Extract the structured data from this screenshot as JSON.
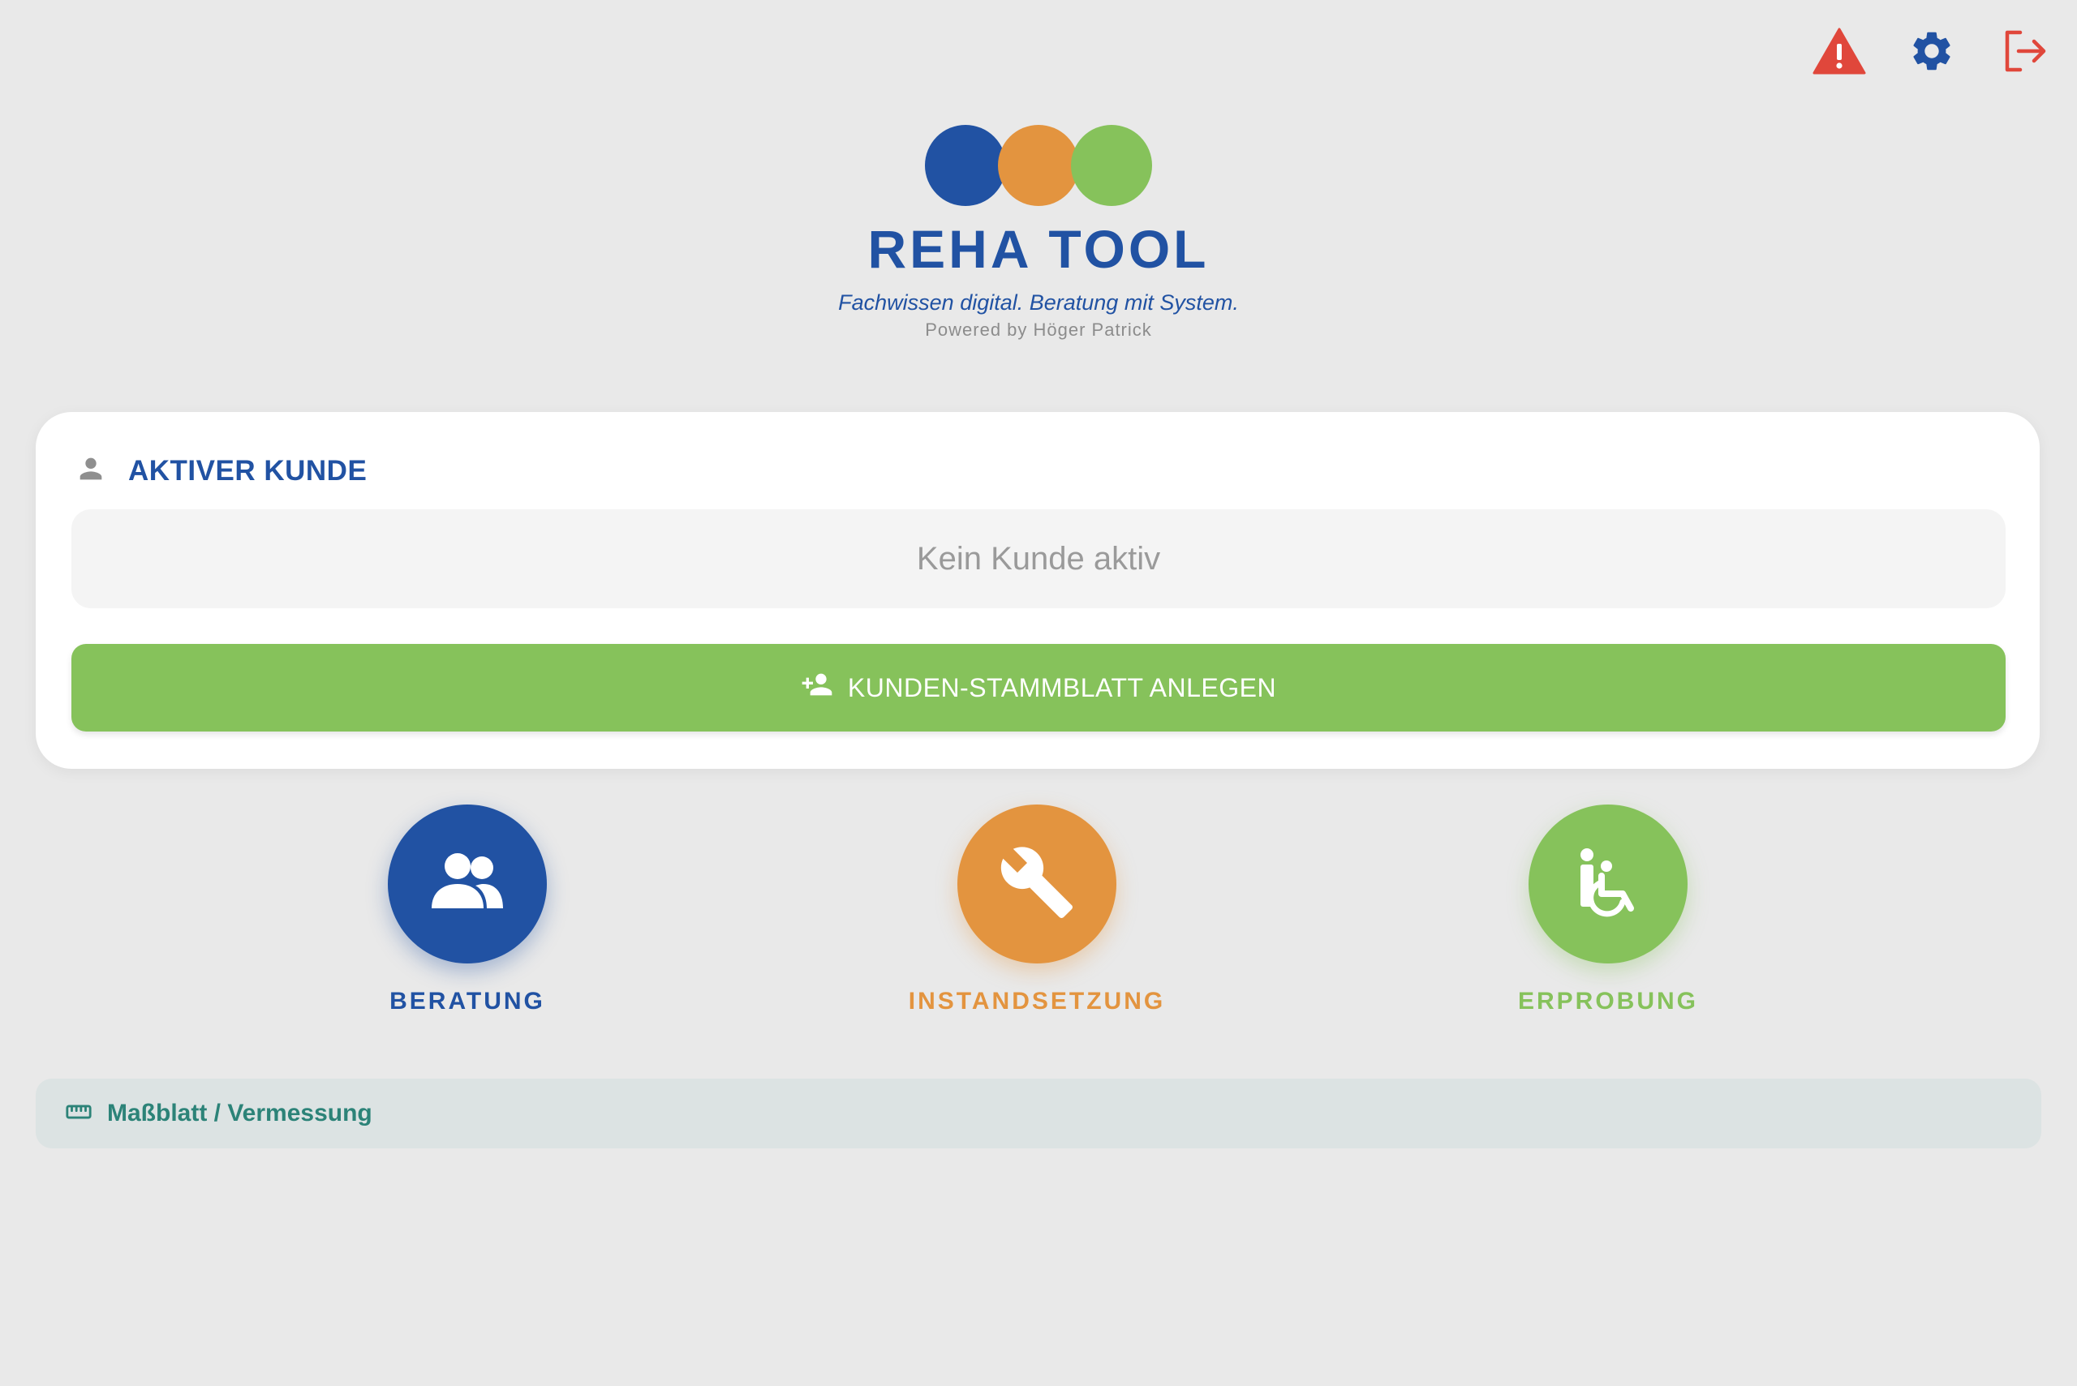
{
  "header": {
    "icons": [
      {
        "name": "warning-icon",
        "color": "#e0473b"
      },
      {
        "name": "gear-icon",
        "color": "#2152a3"
      },
      {
        "name": "logout-icon",
        "color": "#e0473b"
      }
    ]
  },
  "logo": {
    "dot_colors": [
      "#2152a3",
      "#e3943f",
      "#86c25b"
    ],
    "title": "REHA TOOL",
    "tagline": "Fachwissen digital. Beratung mit System.",
    "powered_by": "Powered by Höger Patrick"
  },
  "active_customer": {
    "icon": "person-icon",
    "title": "AKTIVER KUNDE",
    "field_value": "Kein Kunde aktiv",
    "create_button_icon": "person-add-icon",
    "create_button_label": "KUNDEN-STAMMBLATT ANLEGEN"
  },
  "modules": [
    {
      "label": "BERATUNG",
      "icon": "users-icon",
      "color": "#2152a3"
    },
    {
      "label": "INSTANDSETZUNG",
      "icon": "wrench-icon",
      "color": "#e3943f"
    },
    {
      "label": "ERPROBUNG",
      "icon": "wheelchair-icon",
      "color": "#86c25b"
    }
  ],
  "measurement": {
    "icon": "ruler-icon",
    "label": "Maßblatt / Vermessung"
  }
}
